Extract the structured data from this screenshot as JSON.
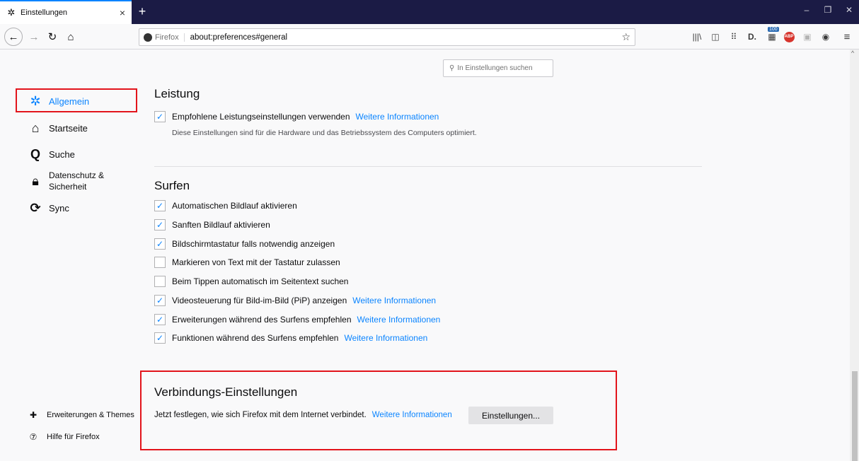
{
  "tab": {
    "title": "Einstellungen",
    "icon": "gear-icon"
  },
  "window": {
    "minimize": "–",
    "restore": "❐",
    "close": "✕"
  },
  "urlbar": {
    "identity": "Firefox",
    "url": "about:preferences#general"
  },
  "toolbar": {
    "badge_count": "100",
    "adblock_label": "ABP"
  },
  "search": {
    "placeholder": "In Einstellungen suchen"
  },
  "sidebar": {
    "items": [
      {
        "label": "Allgemein",
        "icon": "gear-icon",
        "active": true
      },
      {
        "label": "Startseite",
        "icon": "home-icon"
      },
      {
        "label": "Suche",
        "icon": "search-icon"
      },
      {
        "label_line1": "Datenschutz &",
        "label_line2": "Sicherheit",
        "icon": "lock-icon"
      },
      {
        "label": "Sync",
        "icon": "sync-icon"
      }
    ],
    "footer": [
      {
        "label": "Erweiterungen & Themes",
        "icon": "puzzle-icon"
      },
      {
        "label": "Hilfe für Firefox",
        "icon": "help-icon"
      }
    ]
  },
  "sections": {
    "leistung": {
      "title": "Leistung",
      "option": {
        "label": "Empfohlene Leistungseinstellungen verwenden",
        "checked": true,
        "link": "Weitere Informationen"
      },
      "description": "Diese Einstellungen sind für die Hardware und das Betriebssystem des Computers optimiert."
    },
    "surfen": {
      "title": "Surfen",
      "options": [
        {
          "label": "Automatischen Bildlauf aktivieren",
          "checked": true
        },
        {
          "label": "Sanften Bildlauf aktivieren",
          "checked": true
        },
        {
          "label": "Bildschirmtastatur falls notwendig anzeigen",
          "checked": true
        },
        {
          "label": "Markieren von Text mit der Tastatur zulassen",
          "checked": false
        },
        {
          "label": "Beim Tippen automatisch im Seitentext suchen",
          "checked": false
        },
        {
          "label": "Videosteuerung für Bild-im-Bild (PiP) anzeigen",
          "checked": true,
          "link": "Weitere Informationen"
        },
        {
          "label": "Erweiterungen während des Surfens empfehlen",
          "checked": true,
          "link": "Weitere Informationen"
        },
        {
          "label": "Funktionen während des Surfens empfehlen",
          "checked": true,
          "link": "Weitere Informationen"
        }
      ]
    },
    "verbindung": {
      "title": "Verbindungs-Einstellungen",
      "text": "Jetzt festlegen, wie sich Firefox mit dem Internet verbindet.",
      "link": "Weitere Informationen",
      "button": "Einstellungen..."
    }
  },
  "colors": {
    "accent": "#0a84ff",
    "highlight": "#e2141b",
    "tabbar": "#1b1b45"
  }
}
